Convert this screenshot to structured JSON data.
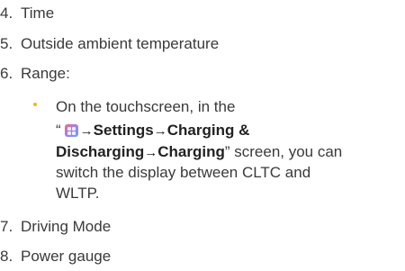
{
  "items": [
    {
      "num": "4.",
      "text": "Time"
    },
    {
      "num": "5.",
      "text": "Outside ambient temperature"
    },
    {
      "num": "6.",
      "text": "Range:"
    },
    {
      "num": "7.",
      "text": "Driving Mode"
    },
    {
      "num": "8.",
      "text": "Power gauge"
    }
  ],
  "range_note": {
    "line1": "On the touchscreen, in the",
    "open_quote": "“",
    "app_icon": "apps-grid-icon",
    "arrow": "→",
    "settings": "Settings",
    "charging_discharging": "Charging &",
    "discharging": "Discharging",
    "charging": "Charging",
    "close_quote_text": "” screen, you can",
    "line4": "switch the display between CLTC and",
    "line5": "WLTP."
  },
  "colors": {
    "bullet": "#f2b233",
    "text": "#3a3a3a"
  }
}
